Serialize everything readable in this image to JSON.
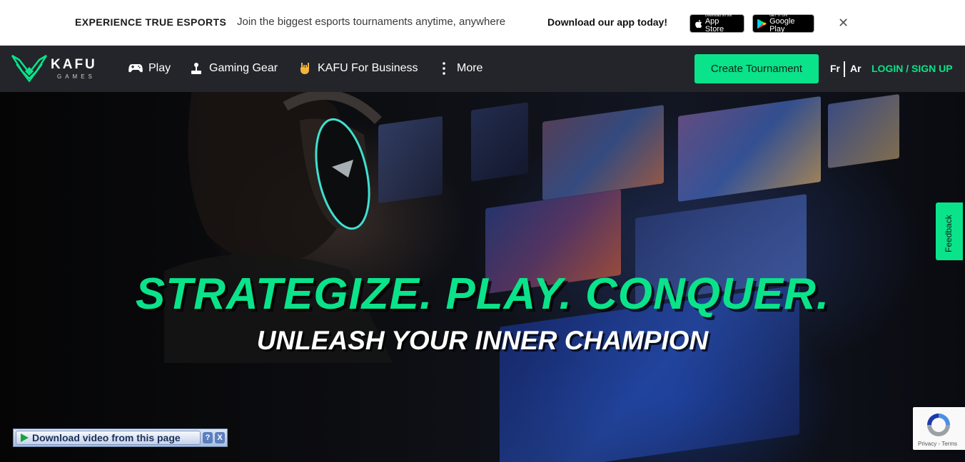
{
  "promo": {
    "title": "EXPERIENCE TRUE ESPORTS",
    "text": "Join the biggest esports tournaments anytime, anywhere",
    "cta": "Download our app today!",
    "app_store": {
      "small": "Download on the",
      "big": "App Store"
    },
    "google_play": {
      "small": "GET IT ON",
      "big": "Google Play"
    },
    "close": "✕"
  },
  "nav": {
    "logo": {
      "name": "KAFU",
      "sub": "GAMES"
    },
    "items": [
      {
        "label": "Play",
        "icon": "gamepad-icon"
      },
      {
        "label": "Gaming Gear",
        "icon": "joystick-icon"
      },
      {
        "label": "KAFU For Business",
        "icon": "rock-hand-icon"
      },
      {
        "label": "More",
        "icon": "more-vertical-icon"
      }
    ],
    "create_tournament": "Create Tournament",
    "languages": [
      "Fr",
      "Ar"
    ],
    "login": "LOGIN / SIGN UP"
  },
  "hero": {
    "title": "STRATEGIZE. PLAY. CONQUER.",
    "subtitle": "UNLEASH YOUR INNER CHAMPION"
  },
  "feedback": "Feedback",
  "download_bar": {
    "label": "Download video from this page",
    "help": "?",
    "close": "X"
  },
  "recaptcha": {
    "privacy": "Privacy",
    "terms": "Terms"
  },
  "colors": {
    "accent": "#0ae38a",
    "nav_bg": "#23252a",
    "promo_bg": "#ffffff"
  }
}
